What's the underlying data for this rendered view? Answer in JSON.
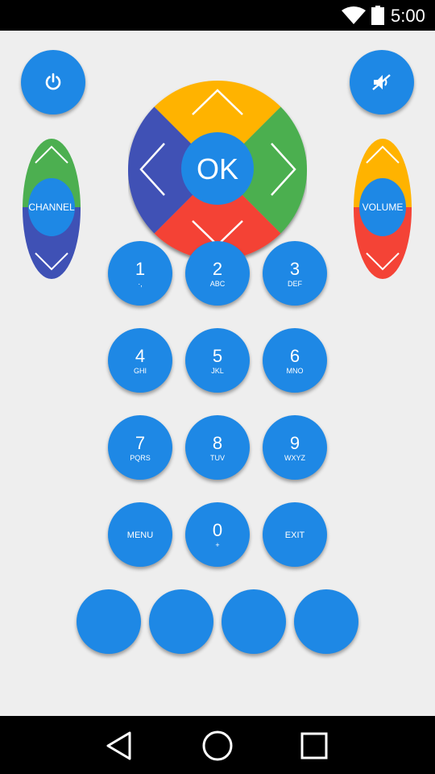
{
  "status_bar": {
    "time": "5:00",
    "icons": [
      "wifi-icon",
      "battery-icon"
    ]
  },
  "remote": {
    "power": {
      "icon": "power-icon"
    },
    "mute": {
      "icon": "mute-icon"
    },
    "dpad": {
      "ok_label": "OK",
      "colors": {
        "up": "#ffb300",
        "right": "#4caf50",
        "down": "#f44336",
        "left": "#3f51b5",
        "center": "#1e88e5"
      }
    },
    "channel": {
      "label": "CHANNEL",
      "colors": {
        "up": "#4caf50",
        "down": "#3f51b5"
      }
    },
    "volume": {
      "label": "VOLUME",
      "colors": {
        "up": "#ffb300",
        "down": "#f44336"
      }
    },
    "keypad": [
      {
        "digit": "1",
        "letters": "·,",
        "name": "1"
      },
      {
        "digit": "2",
        "letters": "ABC",
        "name": "2"
      },
      {
        "digit": "3",
        "letters": "DEF",
        "name": "3"
      },
      {
        "digit": "4",
        "letters": "GHI",
        "name": "4"
      },
      {
        "digit": "5",
        "letters": "JKL",
        "name": "5"
      },
      {
        "digit": "6",
        "letters": "MNO",
        "name": "6"
      },
      {
        "digit": "7",
        "letters": "PQRS",
        "name": "7"
      },
      {
        "digit": "8",
        "letters": "TUV",
        "name": "8"
      },
      {
        "digit": "9",
        "letters": "WXYZ",
        "name": "9"
      },
      {
        "word": "MENU",
        "name": "menu"
      },
      {
        "digit": "0",
        "letters": "+",
        "name": "0"
      },
      {
        "word": "EXIT",
        "name": "exit"
      }
    ],
    "color_buttons": [
      "",
      "",
      "",
      ""
    ],
    "accent_color": "#1e88e5"
  },
  "nav_bar": {
    "icons": [
      "back-icon",
      "home-icon",
      "recents-icon"
    ]
  }
}
